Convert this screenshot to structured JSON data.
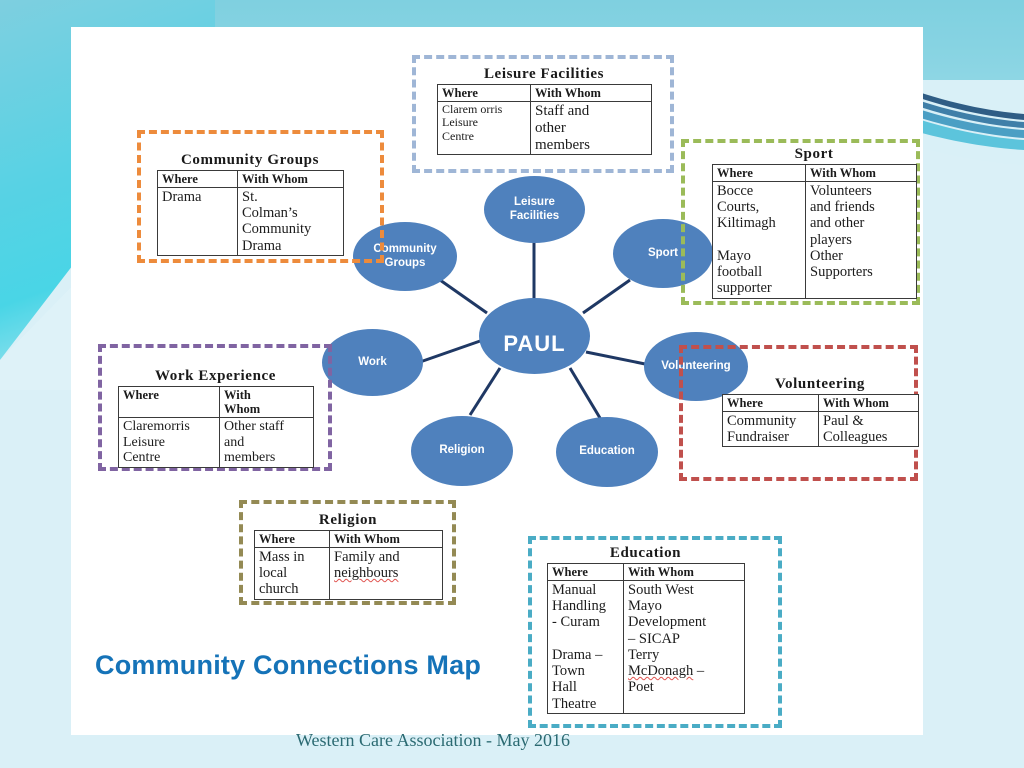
{
  "slide": {
    "title": "Community Connections Map",
    "footer": "Western Care Association - May 2016",
    "accent_color": "#1573b8",
    "node_color": "#4f81bd",
    "background_color": "#daf0f7",
    "panel_color": "#ffffff"
  },
  "diagram": {
    "center": {
      "label": "PAUL"
    },
    "nodes": [
      {
        "id": "leisure",
        "label": "Leisure\nFacilities"
      },
      {
        "id": "community",
        "label": "Community\nGroups"
      },
      {
        "id": "sport",
        "label": "Sport"
      },
      {
        "id": "work",
        "label": "Work"
      },
      {
        "id": "volunteering",
        "label": "Volunteering"
      },
      {
        "id": "religion",
        "label": "Religion"
      },
      {
        "id": "education",
        "label": "Education"
      }
    ]
  },
  "columns": {
    "where": "Where",
    "with_whom": "With Whom",
    "with_whom_wrapped": "With\nWhom"
  },
  "boxes": [
    {
      "id": "leisure",
      "caption": "Leisure Facilities",
      "border_color": "#9fb6d6",
      "header": [
        "Where",
        "With Whom"
      ],
      "rows": [
        [
          "Clarem orris\nLeisure\nCentre",
          "Staff and\nother\nmembers"
        ]
      ]
    },
    {
      "id": "community",
      "caption": "Community Groups",
      "border_color": "#ed8b3c",
      "header": [
        "Where",
        "With Whom"
      ],
      "rows": [
        [
          "Drama",
          "St.\nColman’s\nCommunity\nDrama"
        ]
      ]
    },
    {
      "id": "sport",
      "caption": "Sport",
      "border_color": "#9bbb59",
      "header": [
        "Where",
        "With Whom"
      ],
      "rows": [
        [
          "Bocce\nCourts,\nKiltimagh\n\nMayo\nfootball\nsupporter",
          "Volunteers\nand friends\nand other\nplayers\nOther\nSupporters"
        ]
      ]
    },
    {
      "id": "work",
      "caption": "Work Experience",
      "border_color": "#8064a2",
      "header": [
        "Where",
        "With\nWhom"
      ],
      "rows": [
        [
          "Claremorris\nLeisure\nCentre",
          "Other staff\nand\nmembers"
        ]
      ]
    },
    {
      "id": "volunteering",
      "caption": "Volunteering",
      "border_color": "#c0504d",
      "header": [
        "Where",
        "With Whom"
      ],
      "rows": [
        [
          "Community\nFundraiser",
          "Paul &\nColleagues"
        ]
      ]
    },
    {
      "id": "religion",
      "caption": "Religion",
      "border_color": "#948a54",
      "header": [
        "Where",
        "With Whom"
      ],
      "rows": [
        [
          "Mass in\nlocal\nchurch",
          "Family and\nneighbours"
        ]
      ],
      "misspelled": [
        "neighbours"
      ]
    },
    {
      "id": "education",
      "caption": "Education",
      "border_color": "#4aacc5",
      "header": [
        "Where",
        "With Whom"
      ],
      "rows": [
        [
          "Manual\nHandling\n- Curam\n\nDrama –\nTown\nHall\nTheatre",
          "South West\nMayo\nDevelopment\n– SICAP\nTerry\nMcDonagh –\nPoet"
        ]
      ],
      "misspelled": [
        "McDonagh"
      ]
    }
  ]
}
